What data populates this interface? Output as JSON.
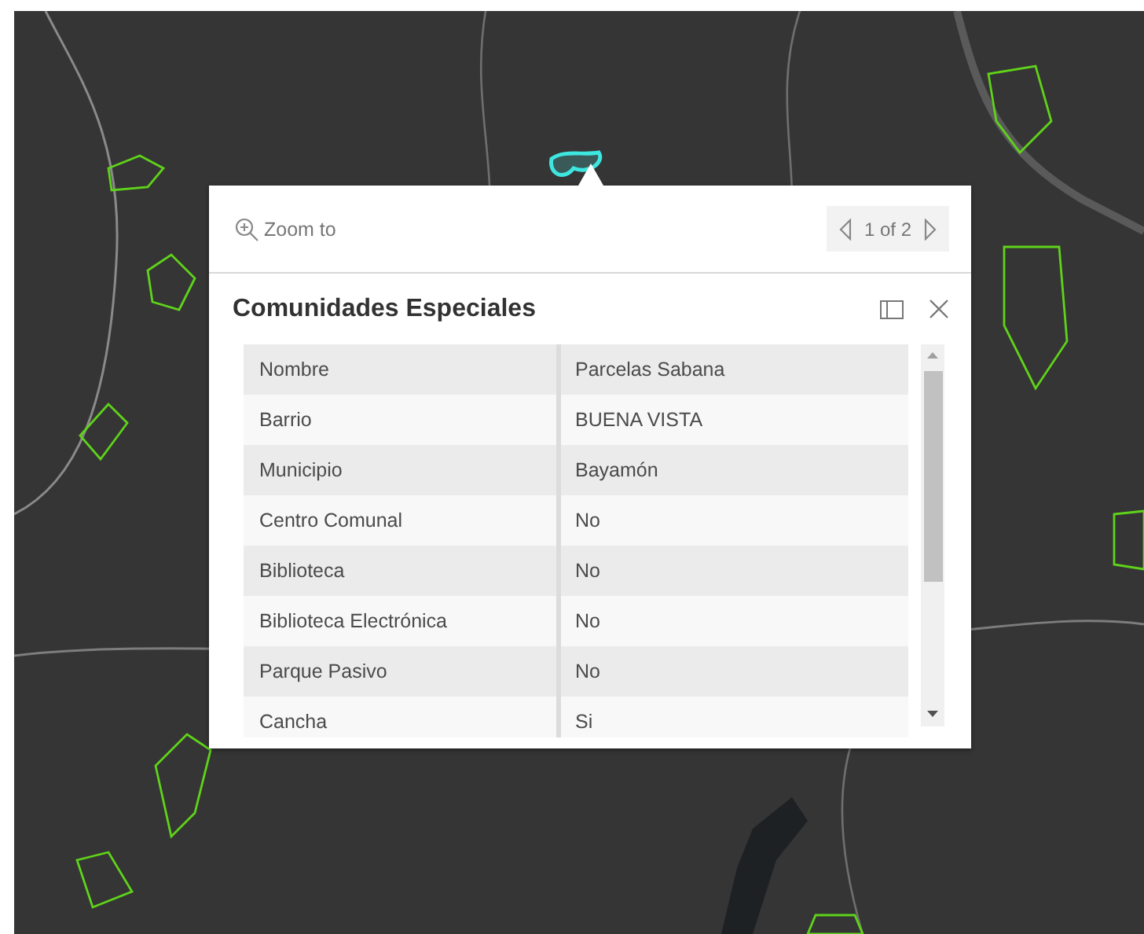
{
  "popup": {
    "zoom_action": "Zoom to",
    "pagination": "1 of 2",
    "title": "Comunidades Especiales",
    "fields": [
      {
        "label": "Nombre",
        "value": "Parcelas Sabana"
      },
      {
        "label": "Barrio",
        "value": "BUENA VISTA"
      },
      {
        "label": "Municipio",
        "value": "Bayamón"
      },
      {
        "label": "Centro Comunal",
        "value": "No"
      },
      {
        "label": "Biblioteca",
        "value": "No"
      },
      {
        "label": "Biblioteca Electrónica",
        "value": "No"
      },
      {
        "label": "Parque Pasivo",
        "value": "No"
      },
      {
        "label": "Cancha",
        "value": "Si"
      }
    ]
  }
}
